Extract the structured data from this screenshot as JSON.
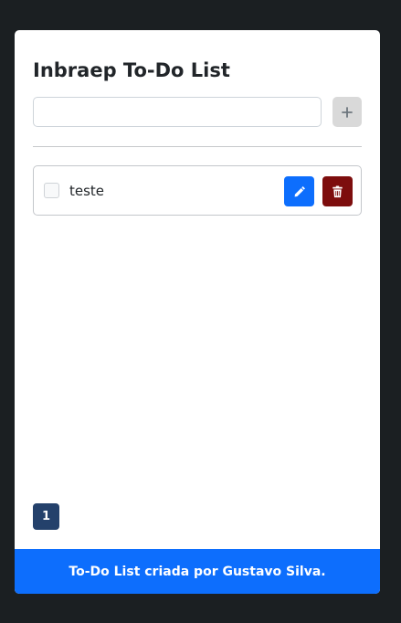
{
  "app": {
    "title": "Inbraep To-Do List"
  },
  "new_task": {
    "value": "",
    "placeholder": "",
    "add_icon": "plus-icon"
  },
  "tasks": [
    {
      "text": "teste",
      "checked": false,
      "edit_icon": "pencil-icon",
      "delete_icon": "trash-icon"
    }
  ],
  "pagination": {
    "current_page": "1"
  },
  "footer": {
    "text": "To-Do List criada por Gustavo Silva."
  },
  "colors": {
    "background": "#1b1f22",
    "primary": "#0d6efd",
    "danger": "#7d0d0d",
    "page_active": "#24416b",
    "add_button": "#d9d9d9"
  }
}
